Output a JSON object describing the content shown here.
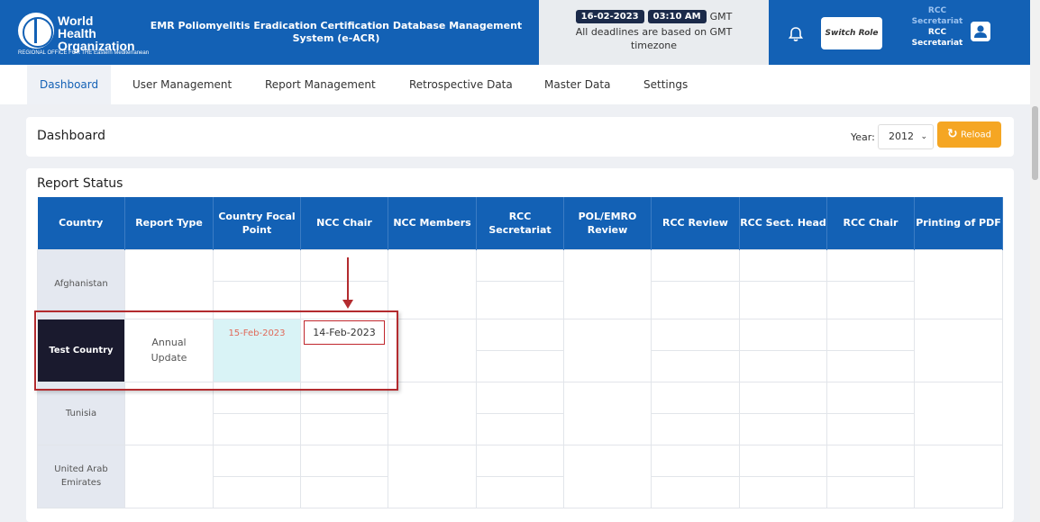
{
  "header": {
    "org_line1": "World Health",
    "org_line2": "Organization",
    "org_region": "REGIONAL OFFICE FOR THE Eastern Mediterranean",
    "system_title": "EMR Poliomyelitis Eradication Certification Database Management System (e-ACR)",
    "date": "16-02-2023",
    "time": "03:10 AM",
    "tz": "GMT",
    "deadline_note": "All deadlines are based on GMT timezone",
    "switch_role_label": "Switch Role",
    "role_line1": "RCC",
    "role_line2": "Secretariat",
    "role_line3": "RCC",
    "role_line4": "Secretariat"
  },
  "nav": {
    "items": [
      "Dashboard",
      "User Management",
      "Report Management",
      "Retrospective Data",
      "Master Data",
      "Settings"
    ],
    "active": "Dashboard"
  },
  "dashboard": {
    "title": "Dashboard",
    "year_label": "Year:",
    "year_value": "2012",
    "reload_label": "Reload"
  },
  "report_status": {
    "title": "Report Status",
    "columns": [
      "Country",
      "Report Type",
      "Country Focal Point",
      "NCC Chair",
      "NCC Members",
      "RCC Secretariat",
      "POL/EMRO Review",
      "RCC Review",
      "RCC Sect. Head",
      "RCC Chair",
      "Printing of PDF"
    ],
    "rows": [
      {
        "country": "Afghanistan",
        "report_type": "",
        "focal_point": "",
        "ncc_chair": ""
      },
      {
        "country": "Test Country",
        "report_type": "Annual Update",
        "focal_point": "15-Feb-2023",
        "ncc_chair": "14-Feb-2023"
      },
      {
        "country": "Tunisia",
        "report_type": "",
        "focal_point": "",
        "ncc_chair": ""
      },
      {
        "country": "United Arab Emirates",
        "report_type": "",
        "focal_point": "",
        "ncc_chair": ""
      }
    ]
  },
  "colors": {
    "primary": "#1361b5",
    "accent": "#f5a623",
    "annotation": "#b32b2f"
  }
}
